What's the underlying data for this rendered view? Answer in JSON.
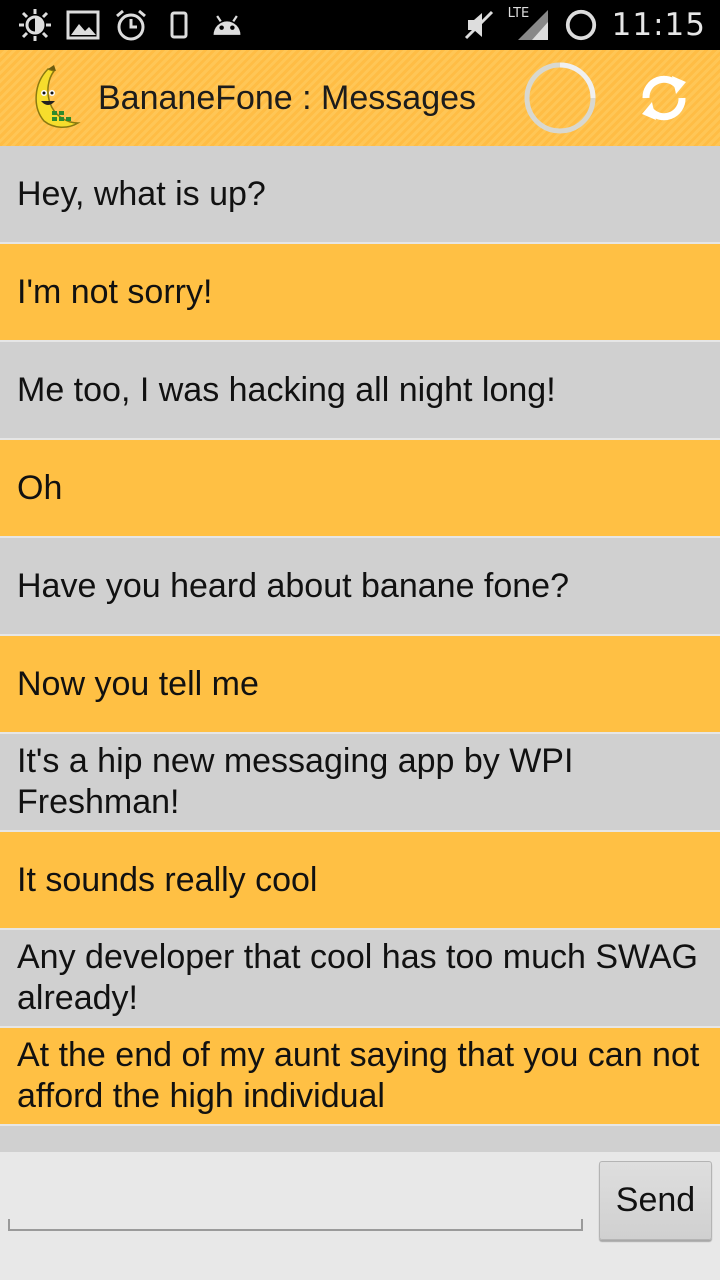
{
  "status_bar": {
    "time": "11:15",
    "network": "LTE",
    "left_icons": [
      "brightness-icon",
      "image-icon",
      "alarm-icon",
      "phone-icon",
      "android-icon"
    ],
    "right_icons": [
      "mute-icon",
      "signal-icon",
      "battery-ring-icon"
    ]
  },
  "action_bar": {
    "title": "BananeFone : Messages",
    "logo_icon": "banana-phone-icon",
    "loading_icon": "spinner-icon",
    "refresh_icon": "refresh-icon",
    "color": "#ffc044"
  },
  "messages": [
    {
      "text": "Hey,  what is up?",
      "style": "grey"
    },
    {
      "text": "I'm not sorry!",
      "style": "orange"
    },
    {
      "text": "Me too,  I was hacking all night long!",
      "style": "grey"
    },
    {
      "text": "Oh",
      "style": "orange"
    },
    {
      "text": "Have you heard about banane fone?",
      "style": "grey"
    },
    {
      "text": "Now you tell me",
      "style": "orange"
    },
    {
      "text": "It's a hip new messaging app by WPI Freshman!",
      "style": "grey"
    },
    {
      "text": "It sounds really cool",
      "style": "orange"
    },
    {
      "text": "Any developer that cool has too much SWAG already!",
      "style": "grey"
    },
    {
      "text": "At the end of my aunt saying that you can not afford the high individual",
      "style": "orange"
    },
    {
      "text": "",
      "style": "grey"
    }
  ],
  "compose": {
    "value": "",
    "placeholder": "",
    "send_label": "Send"
  }
}
